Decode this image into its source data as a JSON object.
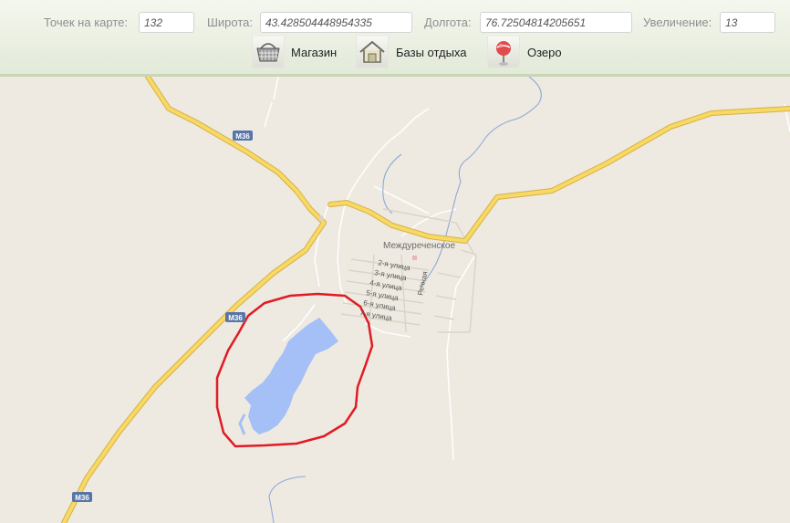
{
  "toolbar": {
    "points": {
      "label": "Точек на карте:",
      "value": "132"
    },
    "latitude": {
      "label": "Широта:",
      "value": "43.428504448954335"
    },
    "longitude": {
      "label": "Долгота:",
      "value": "76.72504814205651"
    },
    "zoom": {
      "label": "Увеличение:",
      "value": "13"
    }
  },
  "legend": {
    "items": [
      {
        "label": "Магазин",
        "icon": "basket-icon"
      },
      {
        "label": "Базы отдыха",
        "icon": "house-icon"
      },
      {
        "label": "Озеро",
        "icon": "map-pin-icon"
      }
    ]
  },
  "map": {
    "village_label": "Междуреченское",
    "highway_shields": [
      "М36",
      "М36",
      "М36"
    ],
    "streets": [
      "2-я улица",
      "3-я улица",
      "4-я улица",
      "5-я улица",
      "6-я улица",
      "7-я улица"
    ],
    "river_street": "Речная",
    "colors": {
      "land": "#eeeae1",
      "highway": "#f5d35c",
      "water": "#a4c0f6",
      "highlight": "#e01b24",
      "shield": "#5775a8"
    }
  }
}
